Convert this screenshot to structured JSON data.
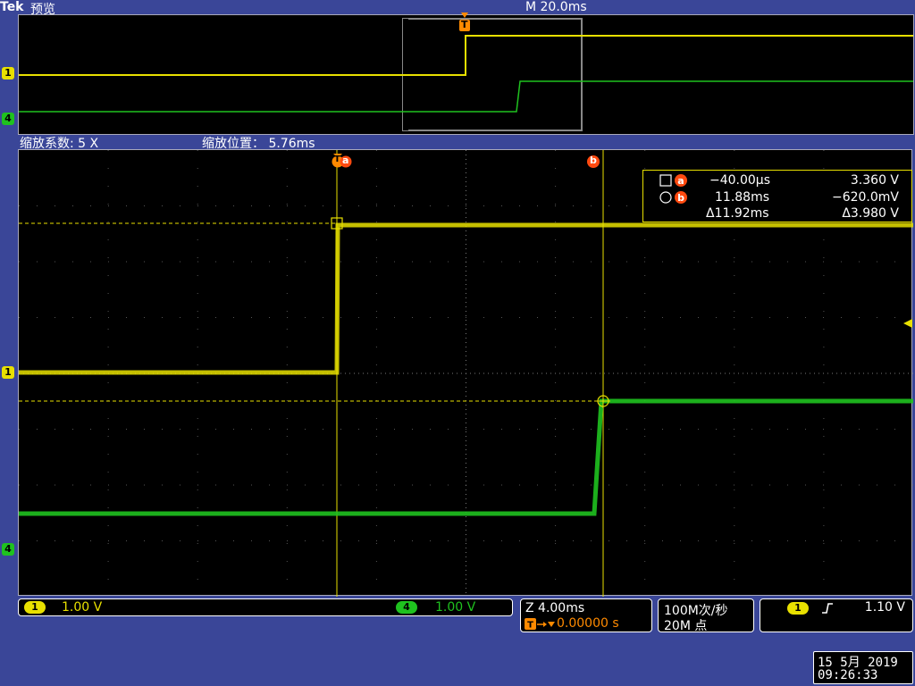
{
  "header": {
    "brand": "Tek",
    "mode": "预览",
    "timebase": "M 20.0ms"
  },
  "zoom": {
    "factor_label": "缩放系数: 5 X",
    "position_label": "缩放位置：  5.76ms"
  },
  "markers": {
    "trigger": "T",
    "cursor_a": "a",
    "cursor_b": "b",
    "ch1": "1",
    "ch4": "4"
  },
  "cursor_readout": {
    "a_time": "−40.00µs",
    "a_volt": "3.360 V",
    "b_time": "11.88ms",
    "b_volt": "−620.0mV",
    "delta_time": "Δ11.92ms",
    "delta_volt": "Δ3.980 V"
  },
  "channels": {
    "ch1_scale": "1.00 V",
    "ch4_scale": "1.00 V"
  },
  "horizontal": {
    "zoom_scale": "Z 4.00ms",
    "trigger_delay": "0.00000 s"
  },
  "acquisition": {
    "rate": "100M次/秒",
    "points": "20M 点"
  },
  "trigger": {
    "source": "1",
    "level": "1.10 V"
  },
  "datetime": {
    "date": "15 5月  2019",
    "time": "09:26:33"
  },
  "colors": {
    "ch1": "#e8e000",
    "ch4": "#1fc21f",
    "background": "#3a4698",
    "trigger_marker": "#ff8a00",
    "cursor_badge": "#ff4a10"
  }
}
